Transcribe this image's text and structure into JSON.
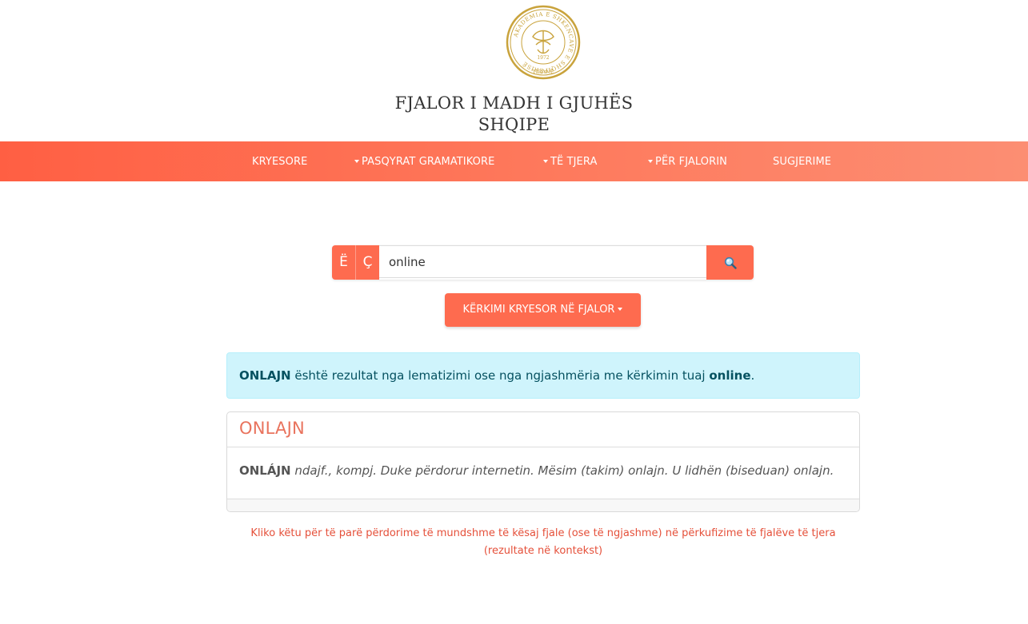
{
  "header": {
    "logo": {
      "ring_text": "AKADEMIA E SHKENCAVE E SHQIPËRISË",
      "year": "1972",
      "city": "TIRANË",
      "color": "#c9a33c"
    },
    "title_line1": "FJALOR I MADH I GJUHËS",
    "title_line2": "SHQIPE"
  },
  "nav": {
    "items": [
      {
        "label": "KRYESORE",
        "dropdown": false
      },
      {
        "label": "PASQYRAT GRAMATIKORE",
        "dropdown": true
      },
      {
        "label": "TË TJERA",
        "dropdown": true
      },
      {
        "label": "PËR FJALORIN",
        "dropdown": true
      },
      {
        "label": "SUGJERIME",
        "dropdown": false
      }
    ],
    "color_start": "#ff5f43",
    "color_end": "#fc8e73"
  },
  "search": {
    "char_buttons": [
      "Ë",
      "Ç"
    ],
    "value": "online",
    "button_icon": "magnifier-icon",
    "mode_label": "KËRKIMI KRYESOR NË FJALOR",
    "accent": "#fe6b4f"
  },
  "alert": {
    "lemma": "ONLAJN",
    "text_middle": " është rezultat nga lematizimi ose nga ngjashmëria me kërkimin tuaj ",
    "query": "online",
    "text_end": "."
  },
  "entry": {
    "title": "ONLAJN",
    "headword": "ONLÁJN",
    "definition": " ndajf., kompj. Duke përdorur internetin. Mësim (takim) onlajn. U lidhën (biseduan) onlajn."
  },
  "context_link": "Kliko këtu për të parë përdorime të mundshme të kësaj fjale (ose të ngjashme) në përkufizime të fjalëve të tjera (rezultate në kontekst)"
}
